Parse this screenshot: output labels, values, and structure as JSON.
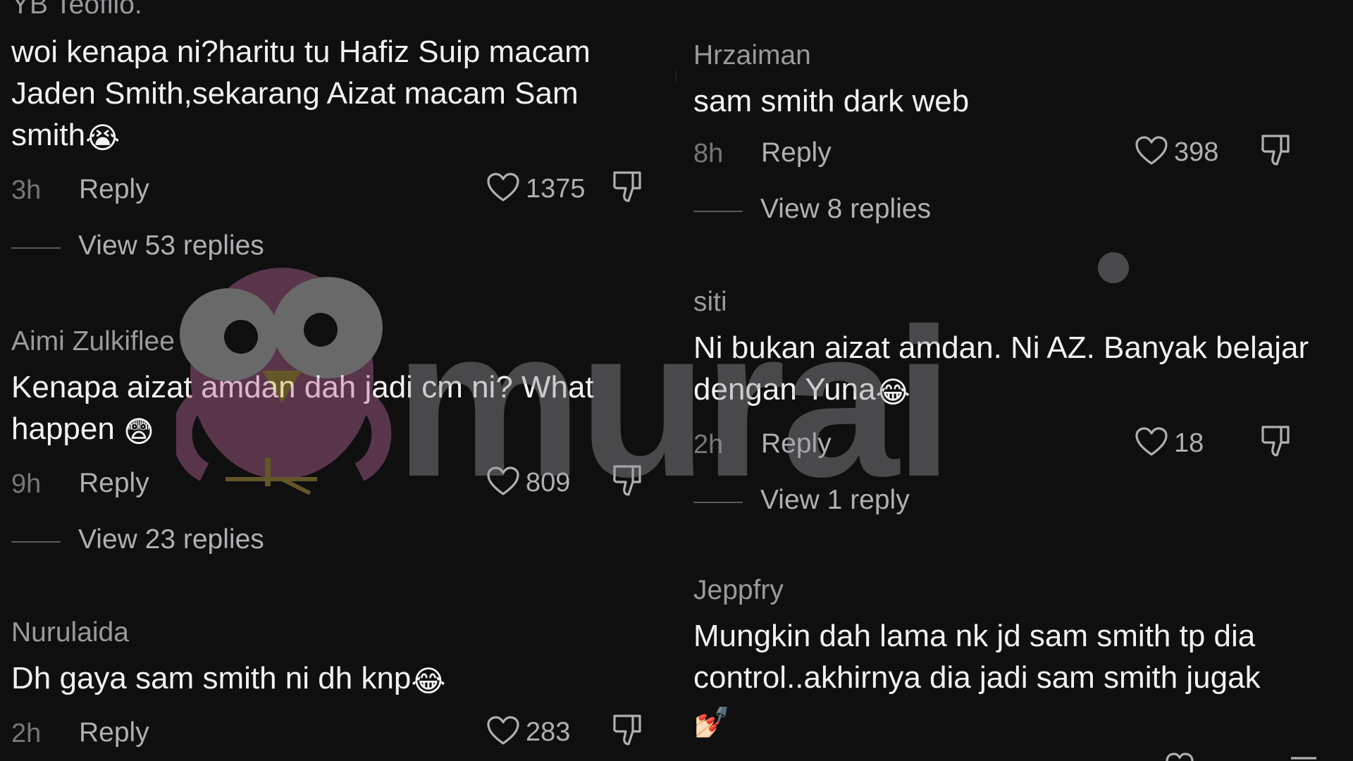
{
  "watermark": {
    "brand_text": "murai",
    "primary_color": "#9a9a9e",
    "mascot_body_color": "#c06a9a",
    "mascot_beak_color": "#d8b84a"
  },
  "comments_left": [
    {
      "username": "YB Teofilo.",
      "text": "woi kenapa ni?haritu tu Hafiz Suip macam Jaden Smith,sekarang Aizat macam Sam smith",
      "emoji": "😭",
      "time": "3h",
      "reply_label": "Reply",
      "likes": "1375",
      "view_replies": "View 53 replies"
    },
    {
      "username": "Aimi Zulkiflee",
      "text": "Kenapa aizat amdan dah jadi cm ni? What happen ",
      "emoji": "😨",
      "time": "9h",
      "reply_label": "Reply",
      "likes": "809",
      "view_replies": "View 23 replies"
    },
    {
      "username": "Nurulaida",
      "text": "Dh gaya sam smith ni dh knp",
      "emoji": "😂",
      "time": "2h",
      "reply_label": "Reply",
      "likes": "283"
    }
  ],
  "comments_right": [
    {
      "username": "Hrzaiman",
      "text": "sam smith dark web",
      "time": "8h",
      "reply_label": "Reply",
      "likes": "398",
      "view_replies": "View 8 replies"
    },
    {
      "username": "siti",
      "text": "Ni bukan aizat amdan. Ni AZ. Banyak belajar dengan Yuna",
      "emoji": "😂",
      "time": "2h",
      "reply_label": "Reply",
      "likes": "18",
      "view_replies": "View 1 reply"
    },
    {
      "username": "Jeppfry",
      "text": "Mungkin dah lama nk jd sam smith tp dia control..akhirnya dia jadi sam smith jugak",
      "emoji": "💅🏻"
    }
  ]
}
